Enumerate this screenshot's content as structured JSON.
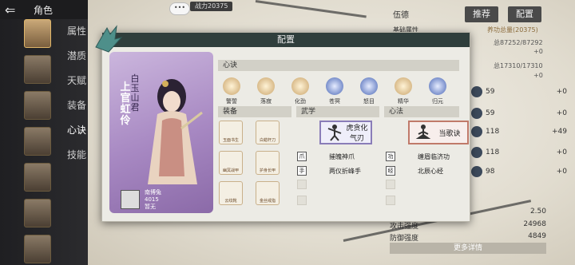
{
  "header": {
    "title": "角色"
  },
  "menu": {
    "items": [
      "属性",
      "潜质",
      "天赋",
      "装备",
      "心诀",
      "技能"
    ]
  },
  "background": {
    "top_badge": "战力20375",
    "stats_tag": "伍德",
    "buttons": [
      "推荐",
      "配置"
    ],
    "base_attr_label": "基础属性",
    "base_attr_value": "养功总量(20375)",
    "hp": "总87252/87292",
    "mp": "总17310/17310",
    "plus0": "+0",
    "rows": [
      {
        "value": "59",
        "delta": "+0"
      },
      {
        "value": "59",
        "delta": "+0"
      },
      {
        "value": "118",
        "delta": "+49"
      },
      {
        "value": "118",
        "delta": "+0"
      },
      {
        "value": "98",
        "delta": "+0"
      }
    ],
    "bottom": [
      {
        "label": "",
        "value": "2.50"
      },
      {
        "label": "攻击强度",
        "value": "24968"
      },
      {
        "label": "防御强度",
        "value": "4849"
      }
    ],
    "more": "更多详情"
  },
  "modal": {
    "title": "配置",
    "card": {
      "name": "上官虹伶",
      "title": "白玉山君",
      "owner_name": "南博兔",
      "owner_power": "4015",
      "owner_status": "暂无"
    },
    "xinjue_label": "心诀",
    "xinjue": [
      {
        "label": "警誓",
        "color": "#c9a36a"
      },
      {
        "label": "落寂",
        "color": "#c9a36a"
      },
      {
        "label": "化劲",
        "color": "#c9a36a"
      },
      {
        "label": "苍冥",
        "color": "#4a67b5"
      },
      {
        "label": "怒目",
        "color": "#4a67b5"
      },
      {
        "label": "精华",
        "color": "#c9a36a"
      },
      {
        "label": "归元",
        "color": "#4a67b5"
      }
    ],
    "equip_label": "装备",
    "equip": [
      {
        "label": "玉面书生"
      },
      {
        "label": "白蜡杆刀"
      },
      {
        "label": "幽冥战甲"
      },
      {
        "label": "护身长甲"
      },
      {
        "label": "云纹靴"
      },
      {
        "label": "金丝戒指"
      }
    ],
    "wuxue_label": "武学",
    "wuxue_main": "虎贪化气刃",
    "wuxue_sub": [
      {
        "icon": "爪",
        "name": "摧魄神爪"
      },
      {
        "icon": "手",
        "name": "两仪折峰手"
      }
    ],
    "xinfa_label": "心法",
    "xinfa_main": "当歌诀",
    "xinfa_sub": [
      {
        "icon": "功",
        "name": "缠眉临济功"
      },
      {
        "icon": "经",
        "name": "北辰心经"
      }
    ]
  }
}
